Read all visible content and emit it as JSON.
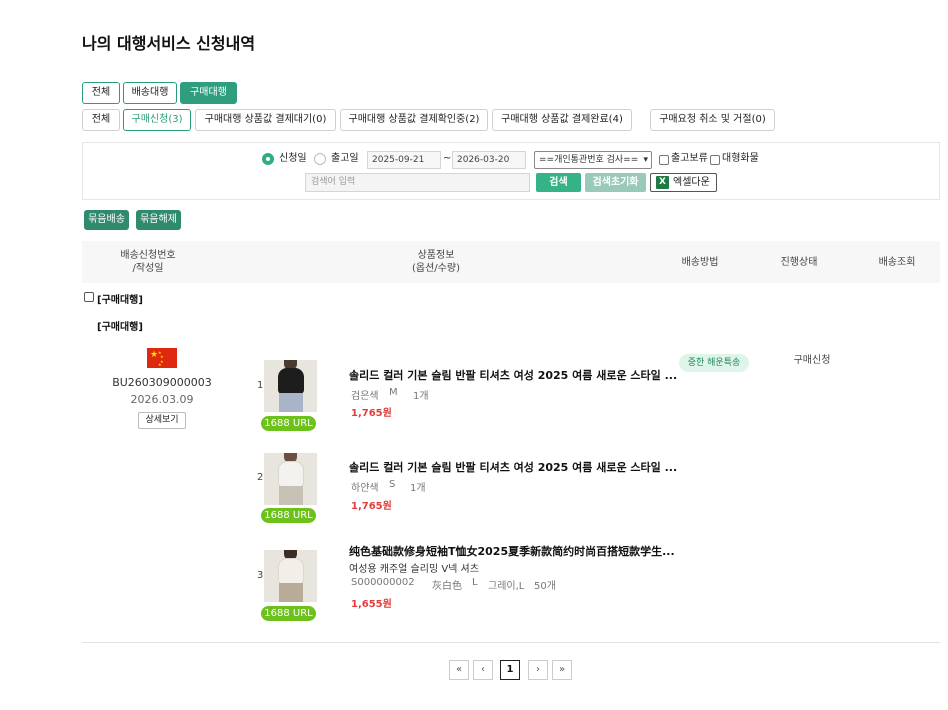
{
  "page": {
    "title": "나의 대행서비스 신청내역"
  },
  "service_tabs": [
    {
      "label": "전체",
      "active": false
    },
    {
      "label": "배송대행",
      "active": false
    },
    {
      "label": "구매대행",
      "active": true
    }
  ],
  "status_tabs": [
    {
      "label": "전체",
      "active": false
    },
    {
      "label": "구매신청(3)",
      "active": true
    },
    {
      "label": "구매대행 상품값 결제대기(0)",
      "active": false
    },
    {
      "label": "구매대행 상품값 결제확인중(2)",
      "active": false
    },
    {
      "label": "구매대행 상품값 결제완료(4)",
      "active": false
    },
    {
      "label": "구매요청 취소 및 거절(0)",
      "active": false
    }
  ],
  "filter": {
    "radio_request_date": "신청일",
    "radio_ship_date": "출고일",
    "date_from": "2025-09-21",
    "date_sep": "~",
    "date_to": "2026-03-20",
    "select_value": "==개인통관번호 검사==",
    "chk_hold": "출고보류",
    "chk_bulky": "대형화물",
    "search_placeholder": "검색어 입력",
    "search_btn": "검색",
    "reset_btn": "검색초기화",
    "excel_btn": "엑셀다운",
    "excel_icon": "X"
  },
  "actions": {
    "bundle": "묶음배송",
    "unbundle": "묶음해제"
  },
  "table_headers": {
    "order_no": "배송신청번호",
    "order_no_sub": "/작성일",
    "product": "상품정보",
    "product_sub": "(옵션/수량)",
    "ship_method": "배송방법",
    "status": "진행상태",
    "tracking": "배송조회"
  },
  "group": {
    "checkbox_label": "[구매대행]",
    "sub_label": "[구매대행]"
  },
  "order": {
    "order_no": "BU260309000003",
    "date": "2026.03.09",
    "detail_btn": "상세보기",
    "ship_method": "중한 해운특송",
    "status": "구매신청",
    "items": [
      {
        "index": "1",
        "url_label": "1688 URL",
        "name": "솔리드 컬러 기본 슬림 반팔 티셔츠 여성 2025 여름 새로운 스타일 ...",
        "color": "검은색",
        "size": "M",
        "qty": "1개",
        "price": "1,765원"
      },
      {
        "index": "2",
        "url_label": "1688 URL",
        "name": "솔리드 컬러 기본 슬림 반팔 티셔츠 여성 2025 여름 새로운 스타일 ...",
        "color": "하얀색",
        "size": "S",
        "qty": "1개",
        "price": "1,765원"
      },
      {
        "index": "3",
        "url_label": "1688 URL",
        "name": "纯色基础款修身短袖T恤女2025夏季新款简约时尚百搭短款学生...",
        "subname": "여성용 캐주얼 슬리밍 V넥 셔츠",
        "sku": "S000000002",
        "color": "灰白色",
        "size": "L",
        "option": "그레이,L",
        "qty": "50개",
        "price": "1,655원"
      }
    ]
  },
  "pagination": {
    "first": "«",
    "prev": "‹",
    "current": "1",
    "next": "›",
    "last": "»"
  },
  "colors": {
    "accent": "#2f9e7e",
    "price": "#e23d3d",
    "url_badge": "#6cc21b"
  }
}
